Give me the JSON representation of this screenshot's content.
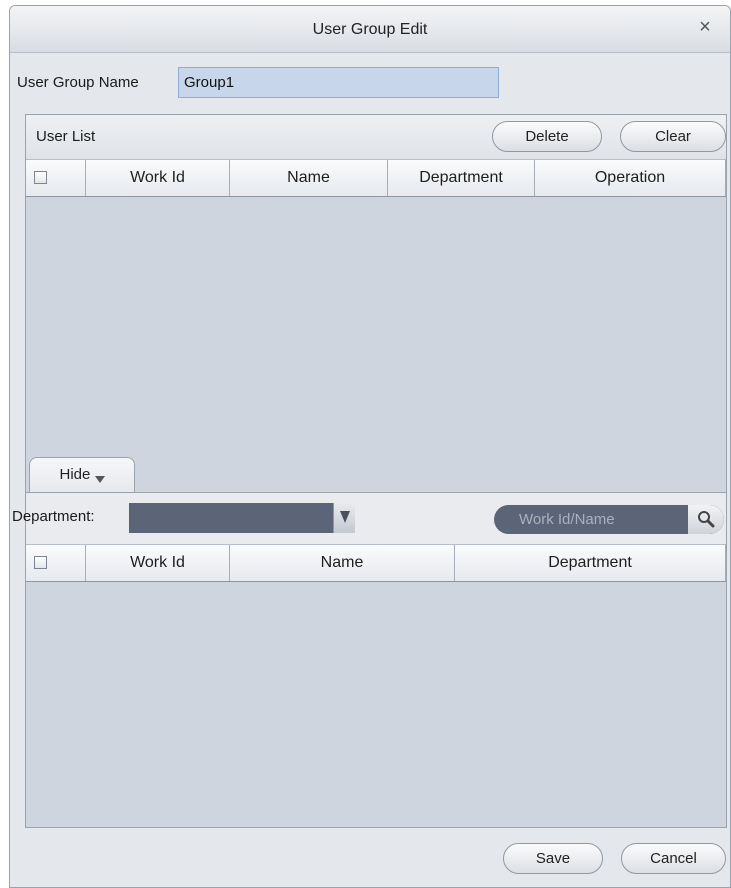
{
  "dialog": {
    "title": "User Group Edit",
    "close_label": "×"
  },
  "group_name": {
    "label": "User Group Name",
    "value": "Group1"
  },
  "user_list": {
    "title": "User List",
    "delete_label": "Delete",
    "clear_label": "Clear",
    "columns": [
      "Work Id",
      "Name",
      "Department",
      "Operation"
    ],
    "rows": []
  },
  "search_pane": {
    "hide_label": "Hide",
    "department_label": "Department:",
    "department_value": "",
    "search_placeholder": "Work Id/Name",
    "columns": [
      "Work Id",
      "Name",
      "Department"
    ],
    "rows": []
  },
  "footer": {
    "save_label": "Save",
    "cancel_label": "Cancel"
  },
  "icons": {
    "close": "close-icon",
    "dropdown": "triangle-down-icon",
    "search": "magnifier-icon",
    "hide_arrow": "chevron-down-icon"
  }
}
